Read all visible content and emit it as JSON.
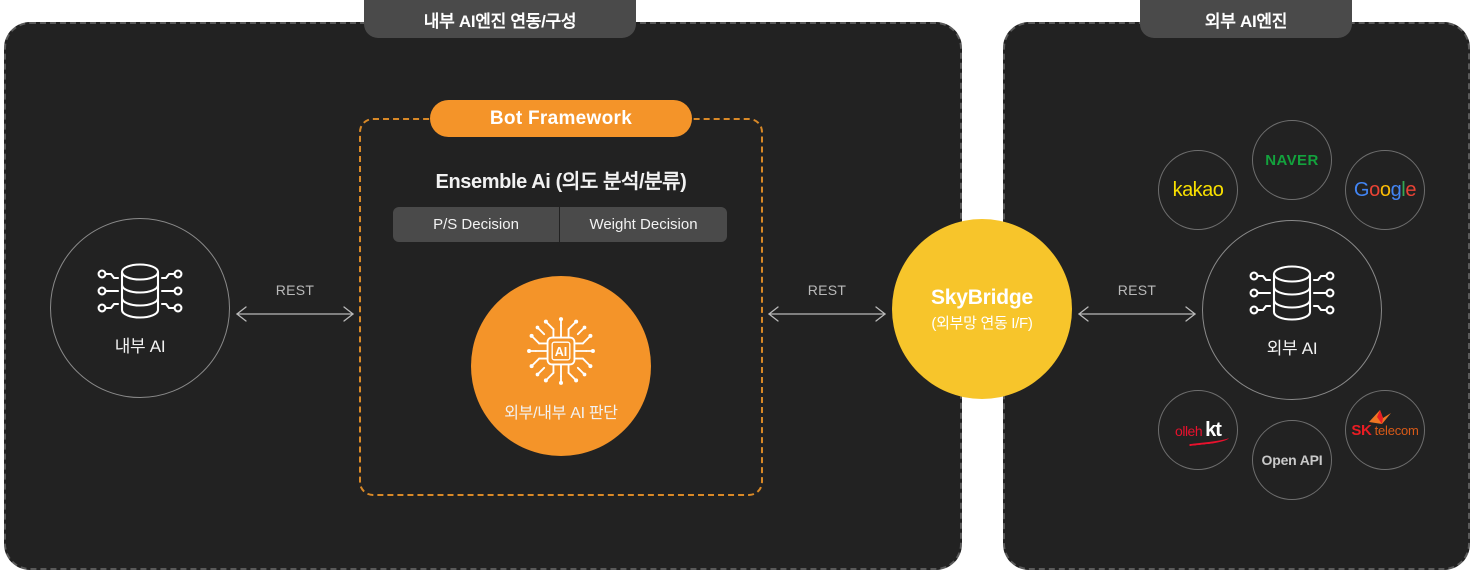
{
  "panels": {
    "left": {
      "tab_label": "내부 AI엔진 연동/구성"
    },
    "right": {
      "tab_label": "외부 AI엔진"
    }
  },
  "bot_framework": {
    "pill_label": "Bot Framework",
    "ensemble_title": "Ensemble Ai (의도 분석/분류)",
    "decisions": [
      {
        "label": "P/S Decision"
      },
      {
        "label": "Weight Decision"
      }
    ],
    "ai_circle": {
      "icon": "ai-chip-icon",
      "chip_text": "AI",
      "label": "외부/내부 AI 판단",
      "color": "#f49429"
    },
    "border_color": "#d98927"
  },
  "nodes": {
    "internal_ai": {
      "label": "내부 AI",
      "icon": "database-network-icon"
    },
    "external_ai": {
      "label": "외부 AI",
      "icon": "database-network-icon"
    },
    "skybridge": {
      "title": "SkyBridge",
      "subtitle": "(외부망 연동 I/F)",
      "color": "#f7c52b"
    }
  },
  "arrows": [
    {
      "label": "REST",
      "name": "arrow-internal-to-bot"
    },
    {
      "label": "REST",
      "name": "arrow-bot-to-skybridge"
    },
    {
      "label": "REST",
      "name": "arrow-skybridge-to-external"
    }
  ],
  "external_logos": [
    {
      "name": "kakao",
      "text": "kakao",
      "color": "#f9e000"
    },
    {
      "name": "naver",
      "text": "NAVER",
      "color": "#13a23d"
    },
    {
      "name": "google",
      "text": "Google",
      "colors": [
        "#4285f4",
        "#ea4335",
        "#fbbc05",
        "#4285f4",
        "#34a853",
        "#ea4335"
      ]
    },
    {
      "name": "olleh-kt",
      "text": "olleh kt",
      "olleh": "olleh",
      "kt": "kt",
      "color": "#e8112d"
    },
    {
      "name": "open-api",
      "text": "Open API",
      "color": "#c9c9c9"
    },
    {
      "name": "sk-telecom",
      "text": "SK telecom",
      "sk": "SK",
      "telecom": "telecom",
      "color": "#ea1c23"
    }
  ]
}
